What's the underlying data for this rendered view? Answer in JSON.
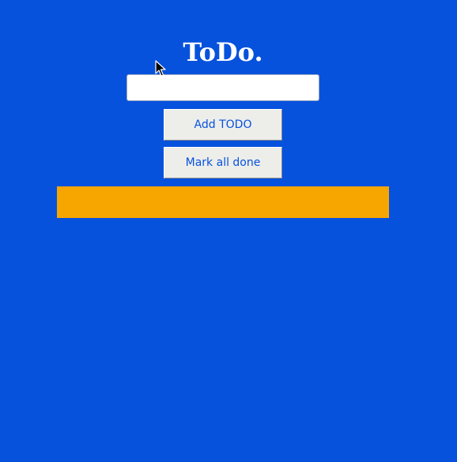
{
  "app": {
    "title": "ToDo."
  },
  "form": {
    "input_value": "",
    "input_placeholder": "",
    "add_button_label": "Add TODO",
    "mark_all_button_label": "Mark all done"
  },
  "todo_list": {
    "items": []
  },
  "colors": {
    "background": "#0652DD",
    "list_background": "#F7A600",
    "button_background": "#EDEDEA",
    "button_text": "#0652DD",
    "title_text": "#FFFFFF"
  },
  "icons": {
    "cursor": "mouse-pointer-icon"
  }
}
